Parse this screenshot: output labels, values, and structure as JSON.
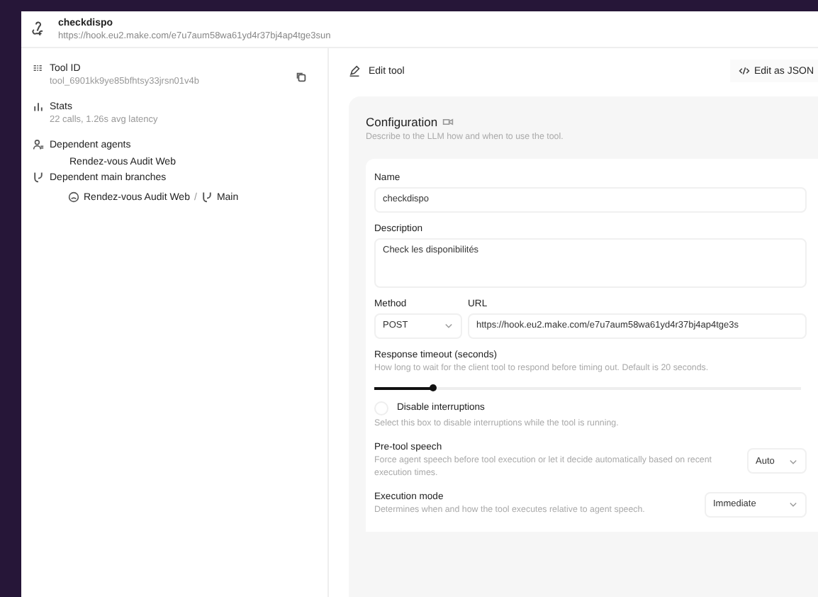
{
  "header": {
    "title": "checkdispo",
    "url": "https://hook.eu2.make.com/e7u7aum58wa61yd4r37bj4ap4tge3sun"
  },
  "sidebar": {
    "tool_id": {
      "label": "Tool ID",
      "value": "tool_6901kk9ye85bfhtsy33jrsn01v4b"
    },
    "stats": {
      "label": "Stats",
      "value": "22 calls, 1.26s avg latency"
    },
    "dependent_agents": {
      "label": "Dependent agents",
      "items": [
        "Rendez-vous Audit Web"
      ]
    },
    "dependent_branches": {
      "label": "Dependent main branches",
      "items": [
        {
          "agent": "Rendez-vous Audit Web",
          "separator": "/",
          "branch": "Main"
        }
      ]
    }
  },
  "editor": {
    "title": "Edit tool",
    "json_button": "Edit as JSON",
    "configuration": {
      "title": "Configuration",
      "subtitle": "Describe to the LLM how and when to use the tool.",
      "name": {
        "label": "Name",
        "value": "checkdispo"
      },
      "description": {
        "label": "Description",
        "value": "Check les disponibilités"
      },
      "method": {
        "label": "Method",
        "value": "POST"
      },
      "url": {
        "label": "URL",
        "value": "https://hook.eu2.make.com/e7u7aum58wa61yd4r37bj4ap4tge3s"
      },
      "timeout": {
        "label": "Response timeout (seconds)",
        "hint": "How long to wait for the client tool to respond before timing out. Default is 20 seconds.",
        "level": 0.14
      },
      "disable_interruptions": {
        "label": "Disable interruptions",
        "checked": false,
        "hint": "Select this box to disable interruptions while the tool is running."
      },
      "pre_tool_speech": {
        "label": "Pre-tool speech",
        "hint": "Force agent speech before tool execution or let it decide automatically based on recent execution times.",
        "value": "Auto"
      },
      "execution_mode": {
        "label": "Execution mode",
        "hint": "Determines when and how the tool executes relative to agent speech.",
        "value": "Immediate"
      }
    }
  }
}
